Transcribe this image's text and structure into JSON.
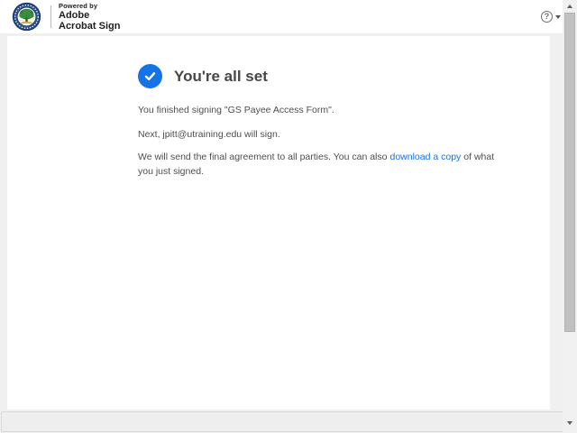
{
  "header": {
    "logo_name": "university-seal",
    "powered_by": "Powered by",
    "brand_line1": "Adobe",
    "brand_line2": "Acrobat Sign",
    "help_label": "?"
  },
  "main": {
    "title": "You're all set",
    "finished_text": "You finished signing \"GS Payee Access Form\".",
    "next_signer_text": "Next, jpitt@utraining.edu will sign.",
    "final_text_before_link": "We will send the final agreement to all parties. You can also",
    "download_link_label": "download a copy",
    "final_text_after_link": "of what you just signed."
  },
  "colors": {
    "accent_blue": "#1473E6",
    "link_blue": "#1473E6",
    "header_text": "#1f1f1f",
    "body_text": "#4e4e4e",
    "page_bg": "#f0f0f0"
  }
}
